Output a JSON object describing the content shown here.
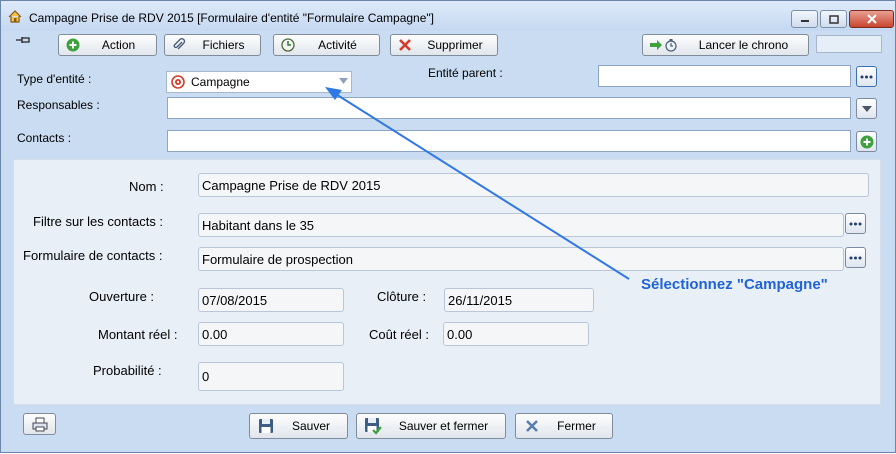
{
  "window": {
    "title": "Campagne Prise de RDV 2015 [Formulaire d'entité \"Formulaire Campagne\"]"
  },
  "toolbar": {
    "action_label": "Action",
    "fichiers_label": "Fichiers",
    "activite_label": "Activité",
    "supprimer_label": "Supprimer",
    "chrono_label": "Lancer le chrono"
  },
  "header_form": {
    "type_label": "Type d'entité :",
    "type_value": "Campagne",
    "parent_label": "Entité parent :",
    "parent_value": "",
    "responsables_label": "Responsables :",
    "responsables_value": "",
    "contacts_label": "Contacts :",
    "contacts_value": ""
  },
  "details": {
    "nom_label": "Nom :",
    "nom_value": "Campagne Prise de RDV 2015",
    "filtre_label": "Filtre sur les contacts :",
    "filtre_value": "Habitant dans le 35",
    "formulaire_label": "Formulaire de contacts :",
    "formulaire_value": "Formulaire de prospection",
    "ouverture_label": "Ouverture :",
    "ouverture_value": "07/08/2015",
    "cloture_label": "Clôture :",
    "cloture_value": "26/11/2015",
    "montant_label": "Montant réel :",
    "montant_value": "0.00",
    "cout_label": "Coût réel :",
    "cout_value": "0.00",
    "probabilite_label": "Probabilité :",
    "probabilite_value": "0"
  },
  "annotation": {
    "text": "Sélectionnez \"Campagne\""
  },
  "footer": {
    "sauver_label": "Sauver",
    "sauver_fermer_label": "Sauver et fermer",
    "fermer_label": "Fermer"
  },
  "icons": {
    "app": "house-icon",
    "minimize": "minimize-icon",
    "maximize": "maximize-icon",
    "close": "close-icon",
    "pin": "pin-icon",
    "action": "plus-circle-icon",
    "fichiers": "paperclip-icon",
    "activite": "clock-icon",
    "supprimer": "delete-x-icon",
    "chrono": "stopwatch-icon",
    "campagne": "target-icon",
    "print": "printer-icon",
    "save": "floppy-icon"
  },
  "colors": {
    "window_bg": "#c9dcf1",
    "panel_bg": "#e9eff7",
    "annotation": "#1f63d6",
    "close_red": "#c9452f"
  }
}
